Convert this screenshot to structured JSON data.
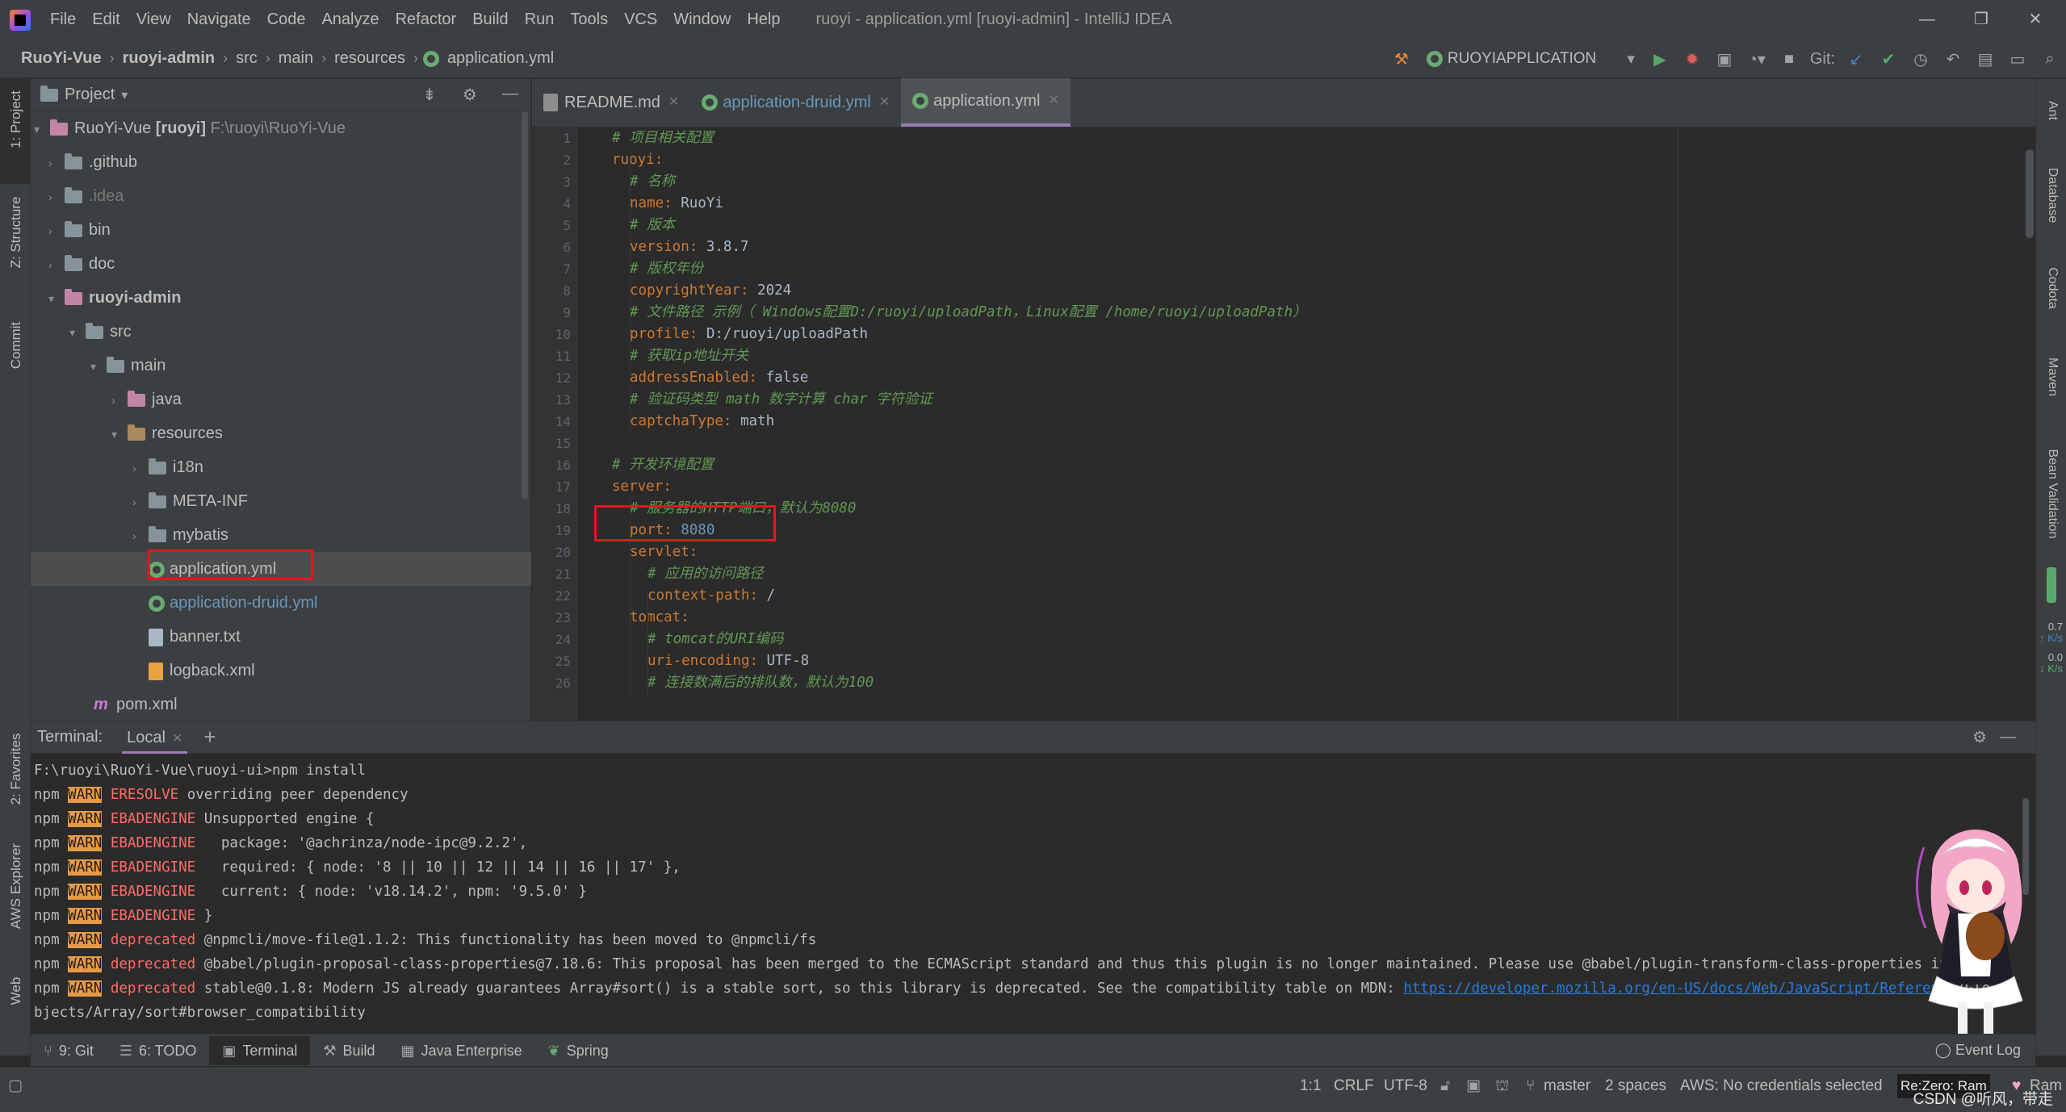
{
  "menubar": {
    "items": [
      "File",
      "Edit",
      "View",
      "Navigate",
      "Code",
      "Analyze",
      "Refactor",
      "Build",
      "Run",
      "Tools",
      "VCS",
      "Window",
      "Help"
    ],
    "window_title": "ruoyi - application.yml [ruoyi-admin] - IntelliJ IDEA"
  },
  "navbar": {
    "crumbs": [
      "RuoYi-Vue",
      "ruoyi-admin",
      "src",
      "main",
      "resources",
      "application.yml"
    ],
    "run_config": "RUOYIAPPLICATION",
    "git_label": "Git:"
  },
  "left_stripe": {
    "project": "1: Project",
    "structure": "Z: Structure",
    "commit": "Commit",
    "favorites": "2: Favorites",
    "aws": "AWS Explorer",
    "web": "Web"
  },
  "right_stripe": {
    "ant": "Ant",
    "database": "Database",
    "codota": "Codota",
    "maven": "Maven",
    "bean": "Bean Validation",
    "speed_up": "0.7",
    "speed_up_unit": "K/s",
    "speed_down": "0.0",
    "speed_down_unit": "K/s"
  },
  "project_panel": {
    "title": "Project",
    "root_name": "RuoYi-Vue",
    "root_module": "[ruoyi]",
    "root_path": "F:\\ruoyi\\RuoYi-Vue",
    "items": {
      "github": ".github",
      "idea": ".idea",
      "bin": "bin",
      "doc": "doc",
      "ruoyi_admin": "ruoyi-admin",
      "src": "src",
      "main": "main",
      "java": "java",
      "resources": "resources",
      "i18n": "i18n",
      "meta_inf": "META-INF",
      "mybatis": "mybatis",
      "application_yml": "application.yml",
      "application_druid_yml": "application-druid.yml",
      "banner_txt": "banner.txt",
      "logback_xml": "logback.xml",
      "pom_xml": "pom.xml"
    }
  },
  "editor": {
    "tabs": [
      "README.md",
      "application-druid.yml",
      "application.yml"
    ],
    "active_tab": "application.yml",
    "lines": [
      {
        "n": "1",
        "indent": 0,
        "comment": "# 项目相关配置"
      },
      {
        "n": "2",
        "indent": 0,
        "key": "ruoyi",
        "sep": ":"
      },
      {
        "n": "3",
        "indent": 1,
        "comment": "# 名称"
      },
      {
        "n": "4",
        "indent": 1,
        "key": "name",
        "sep": ": ",
        "value": "RuoYi"
      },
      {
        "n": "5",
        "indent": 1,
        "comment": "# 版本"
      },
      {
        "n": "6",
        "indent": 1,
        "key": "version",
        "sep": ": ",
        "value": "3.8.7"
      },
      {
        "n": "7",
        "indent": 1,
        "comment": "# 版权年份"
      },
      {
        "n": "8",
        "indent": 1,
        "key": "copyrightYear",
        "sep": ": ",
        "value": "2024"
      },
      {
        "n": "9",
        "indent": 1,
        "comment": "# 文件路径 示例（ Windows配置D:/ruoyi/uploadPath，Linux配置 /home/ruoyi/uploadPath）"
      },
      {
        "n": "10",
        "indent": 1,
        "key": "profile",
        "sep": ": ",
        "value": "D:/ruoyi/uploadPath"
      },
      {
        "n": "11",
        "indent": 1,
        "comment": "# 获取ip地址开关"
      },
      {
        "n": "12",
        "indent": 1,
        "key": "addressEnabled",
        "sep": ": ",
        "value": "false"
      },
      {
        "n": "13",
        "indent": 1,
        "comment": "# 验证码类型 math 数字计算 char 字符验证"
      },
      {
        "n": "14",
        "indent": 1,
        "key": "captchaType",
        "sep": ": ",
        "value": "math"
      },
      {
        "n": "15",
        "indent": 0
      },
      {
        "n": "16",
        "indent": 0,
        "comment": "# 开发环境配置"
      },
      {
        "n": "17",
        "indent": 0,
        "key": "server",
        "sep": ":"
      },
      {
        "n": "18",
        "indent": 1,
        "comment": "# 服务器的HTTP端口，默认为8080"
      },
      {
        "n": "19",
        "indent": 1,
        "key": "port",
        "sep": ": ",
        "number": "8080"
      },
      {
        "n": "20",
        "indent": 1,
        "key": "servlet",
        "sep": ":"
      },
      {
        "n": "21",
        "indent": 2,
        "comment": "# 应用的访问路径"
      },
      {
        "n": "22",
        "indent": 2,
        "key": "context-path",
        "sep": ": ",
        "value": "/"
      },
      {
        "n": "23",
        "indent": 1,
        "key": "tomcat",
        "sep": ":"
      },
      {
        "n": "24",
        "indent": 2,
        "comment": "# tomcat的URI编码"
      },
      {
        "n": "25",
        "indent": 2,
        "key": "uri-encoding",
        "sep": ": ",
        "value": "UTF-8"
      },
      {
        "n": "26",
        "indent": 2,
        "comment": "# 连接数满后的排队数，默认为100"
      }
    ]
  },
  "terminal": {
    "label": "Terminal:",
    "tab": "Local",
    "lines": [
      {
        "plain": "F:\\ruoyi\\RuoYi-Vue\\ruoyi-ui>npm install"
      },
      {
        "npm": "npm",
        "warn": "WARN",
        "code": "ERESOLVE",
        "text": " overriding peer dependency"
      },
      {
        "npm": "npm",
        "warn": "WARN",
        "code": "EBADENGINE",
        "text": " Unsupported engine {"
      },
      {
        "npm": "npm",
        "warn": "WARN",
        "code": "EBADENGINE",
        "text": "   package: '@achrinza/node-ipc@9.2.2',"
      },
      {
        "npm": "npm",
        "warn": "WARN",
        "code": "EBADENGINE",
        "text": "   required: { node: '8 || 10 || 12 || 14 || 16 || 17' },"
      },
      {
        "npm": "npm",
        "warn": "WARN",
        "code": "EBADENGINE",
        "text": "   current: { node: 'v18.14.2', npm: '9.5.0' }"
      },
      {
        "npm": "npm",
        "warn": "WARN",
        "code": "EBADENGINE",
        "text": " }"
      },
      {
        "npm": "npm",
        "warn": "WARN",
        "code": "deprecated",
        "text": " @npmcli/move-file@1.1.2: This functionality has been moved to @npmcli/fs"
      },
      {
        "npm": "npm",
        "warn": "WARN",
        "code": "deprecated",
        "text": " @babel/plugin-proposal-class-properties@7.18.6: This proposal has been merged to the ECMAScript standard and thus this plugin is no longer maintained. Please use @babel/plugin-transform-class-properties inst"
      },
      {
        "npm": "npm",
        "warn": "WARN",
        "code": "deprecated",
        "text": " stable@0.1.8: Modern JS already guarantees Array#sort() is a stable sort, so this library is deprecated. See the compatibility table on MDN: ",
        "link": "https://developer.mozilla.org/en-US/docs/Web/JavaScript/Reference",
        "tail": "/Glo"
      },
      {
        "plain": "bjects/Array/sort#browser_compatibility"
      }
    ]
  },
  "bottom_tabs": {
    "git": "9: Git",
    "todo": "6: TODO",
    "terminal": "Terminal",
    "build": "Build",
    "java_ee": "Java Enterprise",
    "spring": "Spring",
    "event_log": "Event Log"
  },
  "statusbar": {
    "position": "1:1",
    "line_sep": "CRLF",
    "encoding": "UTF-8",
    "branch": "master",
    "indent": "2 spaces",
    "aws": "AWS: No credentials selected",
    "theme": "Re:Zero: Ram",
    "theme2": "Ram",
    "watermark": "CSDN @听风，带走"
  },
  "colors": {
    "highlight_box": "#e3171b",
    "accent_tab": "#9b7bb5",
    "yaml_key": "#cc7832",
    "comment": "#629755",
    "number": "#6897bb"
  }
}
